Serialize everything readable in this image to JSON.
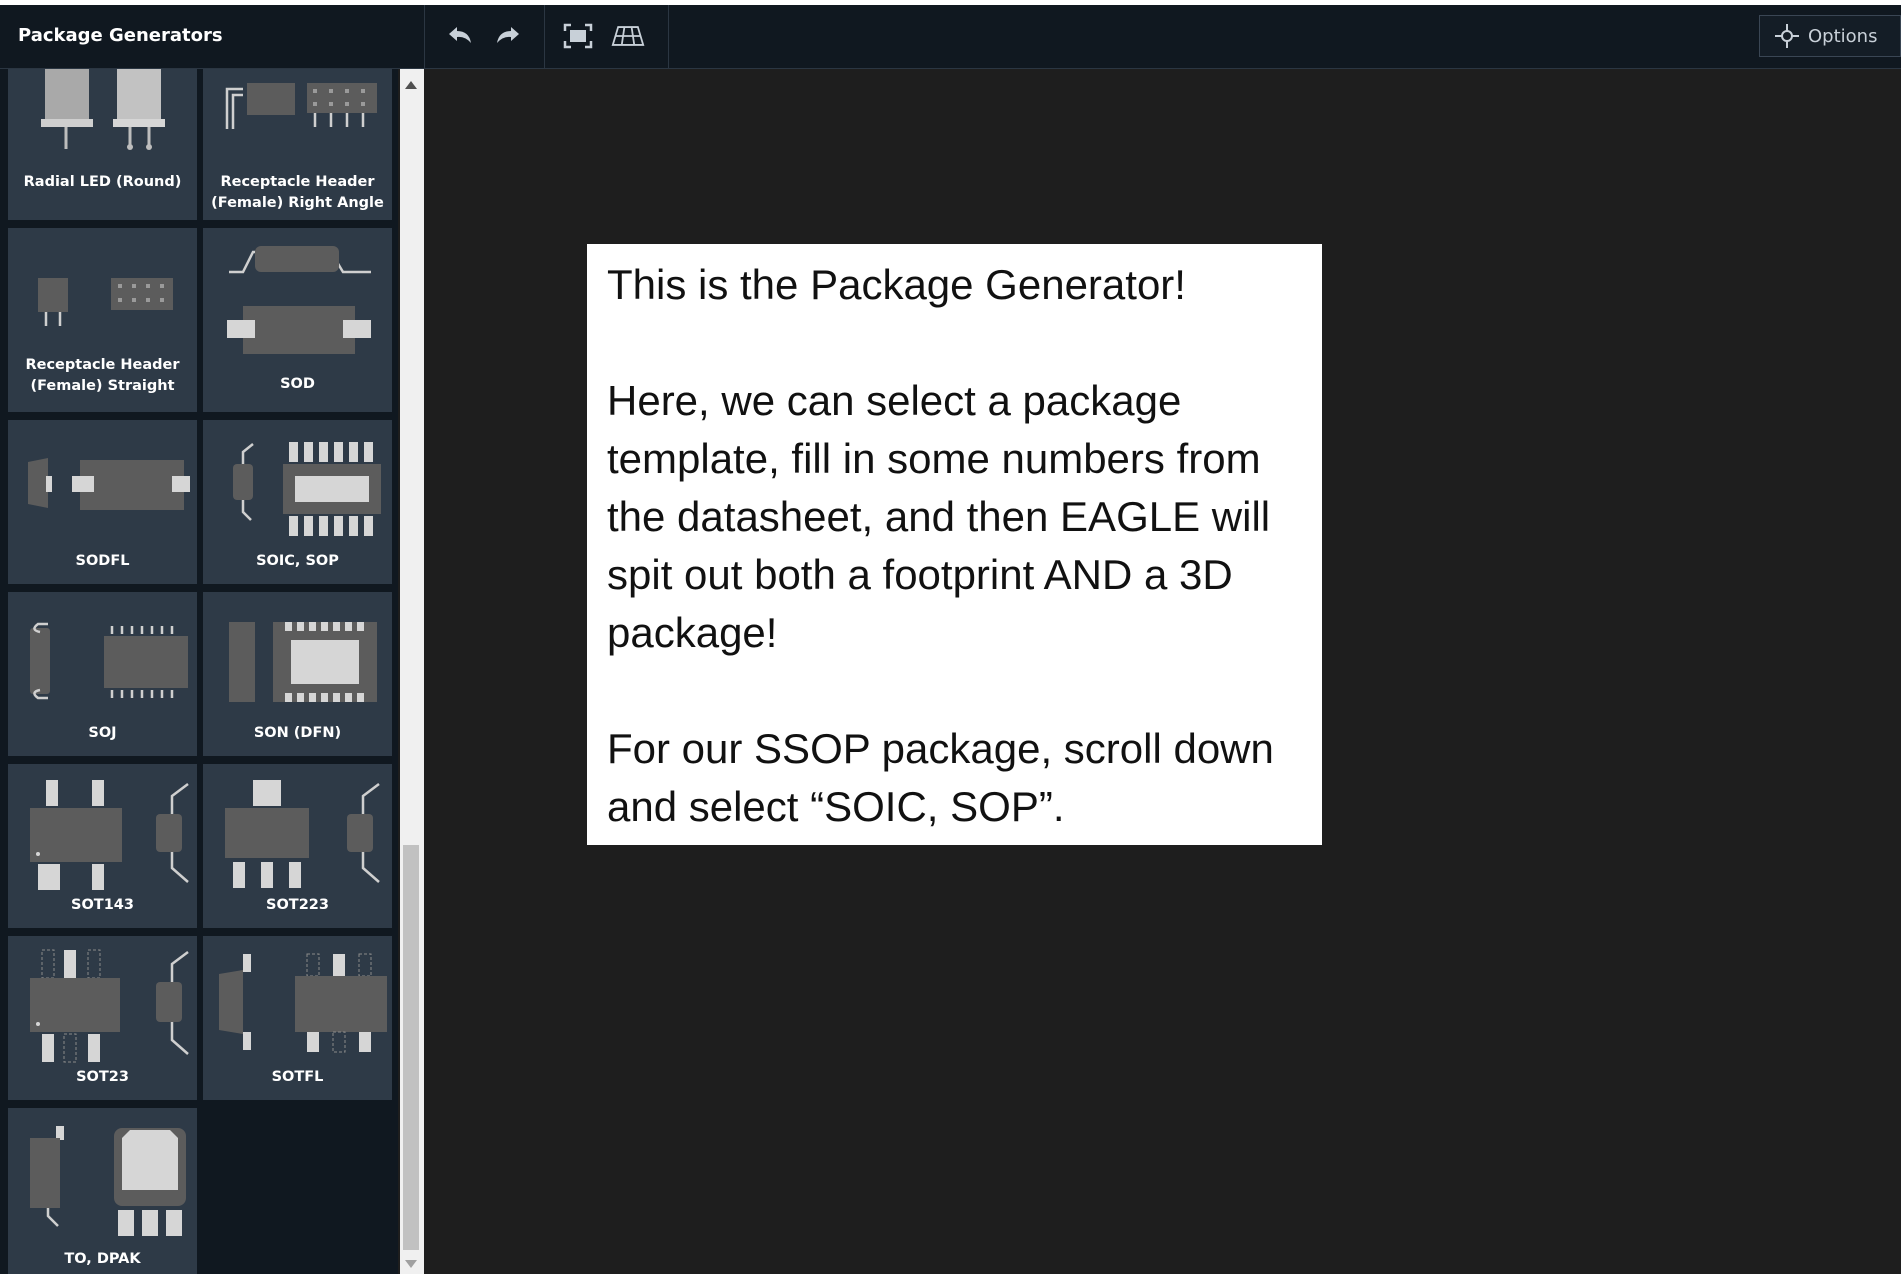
{
  "panel": {
    "title": "Package Generators"
  },
  "toolbar": {
    "undo_icon": "undo-icon",
    "redo_icon": "redo-icon",
    "fit_icon": "fit-view-icon",
    "grid_icon": "3d-grid-icon",
    "options_label": "Options",
    "options_icon": "crosshair-icon"
  },
  "tiles": [
    {
      "label": "Radial LED (Round)"
    },
    {
      "label": "Receptacle Header (Female) Right Angle"
    },
    {
      "label": "Receptacle Header (Female) Straight"
    },
    {
      "label": "SOD"
    },
    {
      "label": "SODFL"
    },
    {
      "label": "SOIC, SOP"
    },
    {
      "label": "SOJ"
    },
    {
      "label": "SON (DFN)"
    },
    {
      "label": "SOT143"
    },
    {
      "label": "SOT223"
    },
    {
      "label": "SOT23"
    },
    {
      "label": "SOTFL"
    },
    {
      "label": "TO, DPAK"
    }
  ],
  "callout": {
    "p1": "This is the Package Generator!",
    "p2": "Here, we can select a package template, fill in some numbers from the datasheet, and then EAGLE will spit out both a footprint AND a 3D package!",
    "p3": "For our SSOP package, scroll down and select “SOIC, SOP”."
  }
}
